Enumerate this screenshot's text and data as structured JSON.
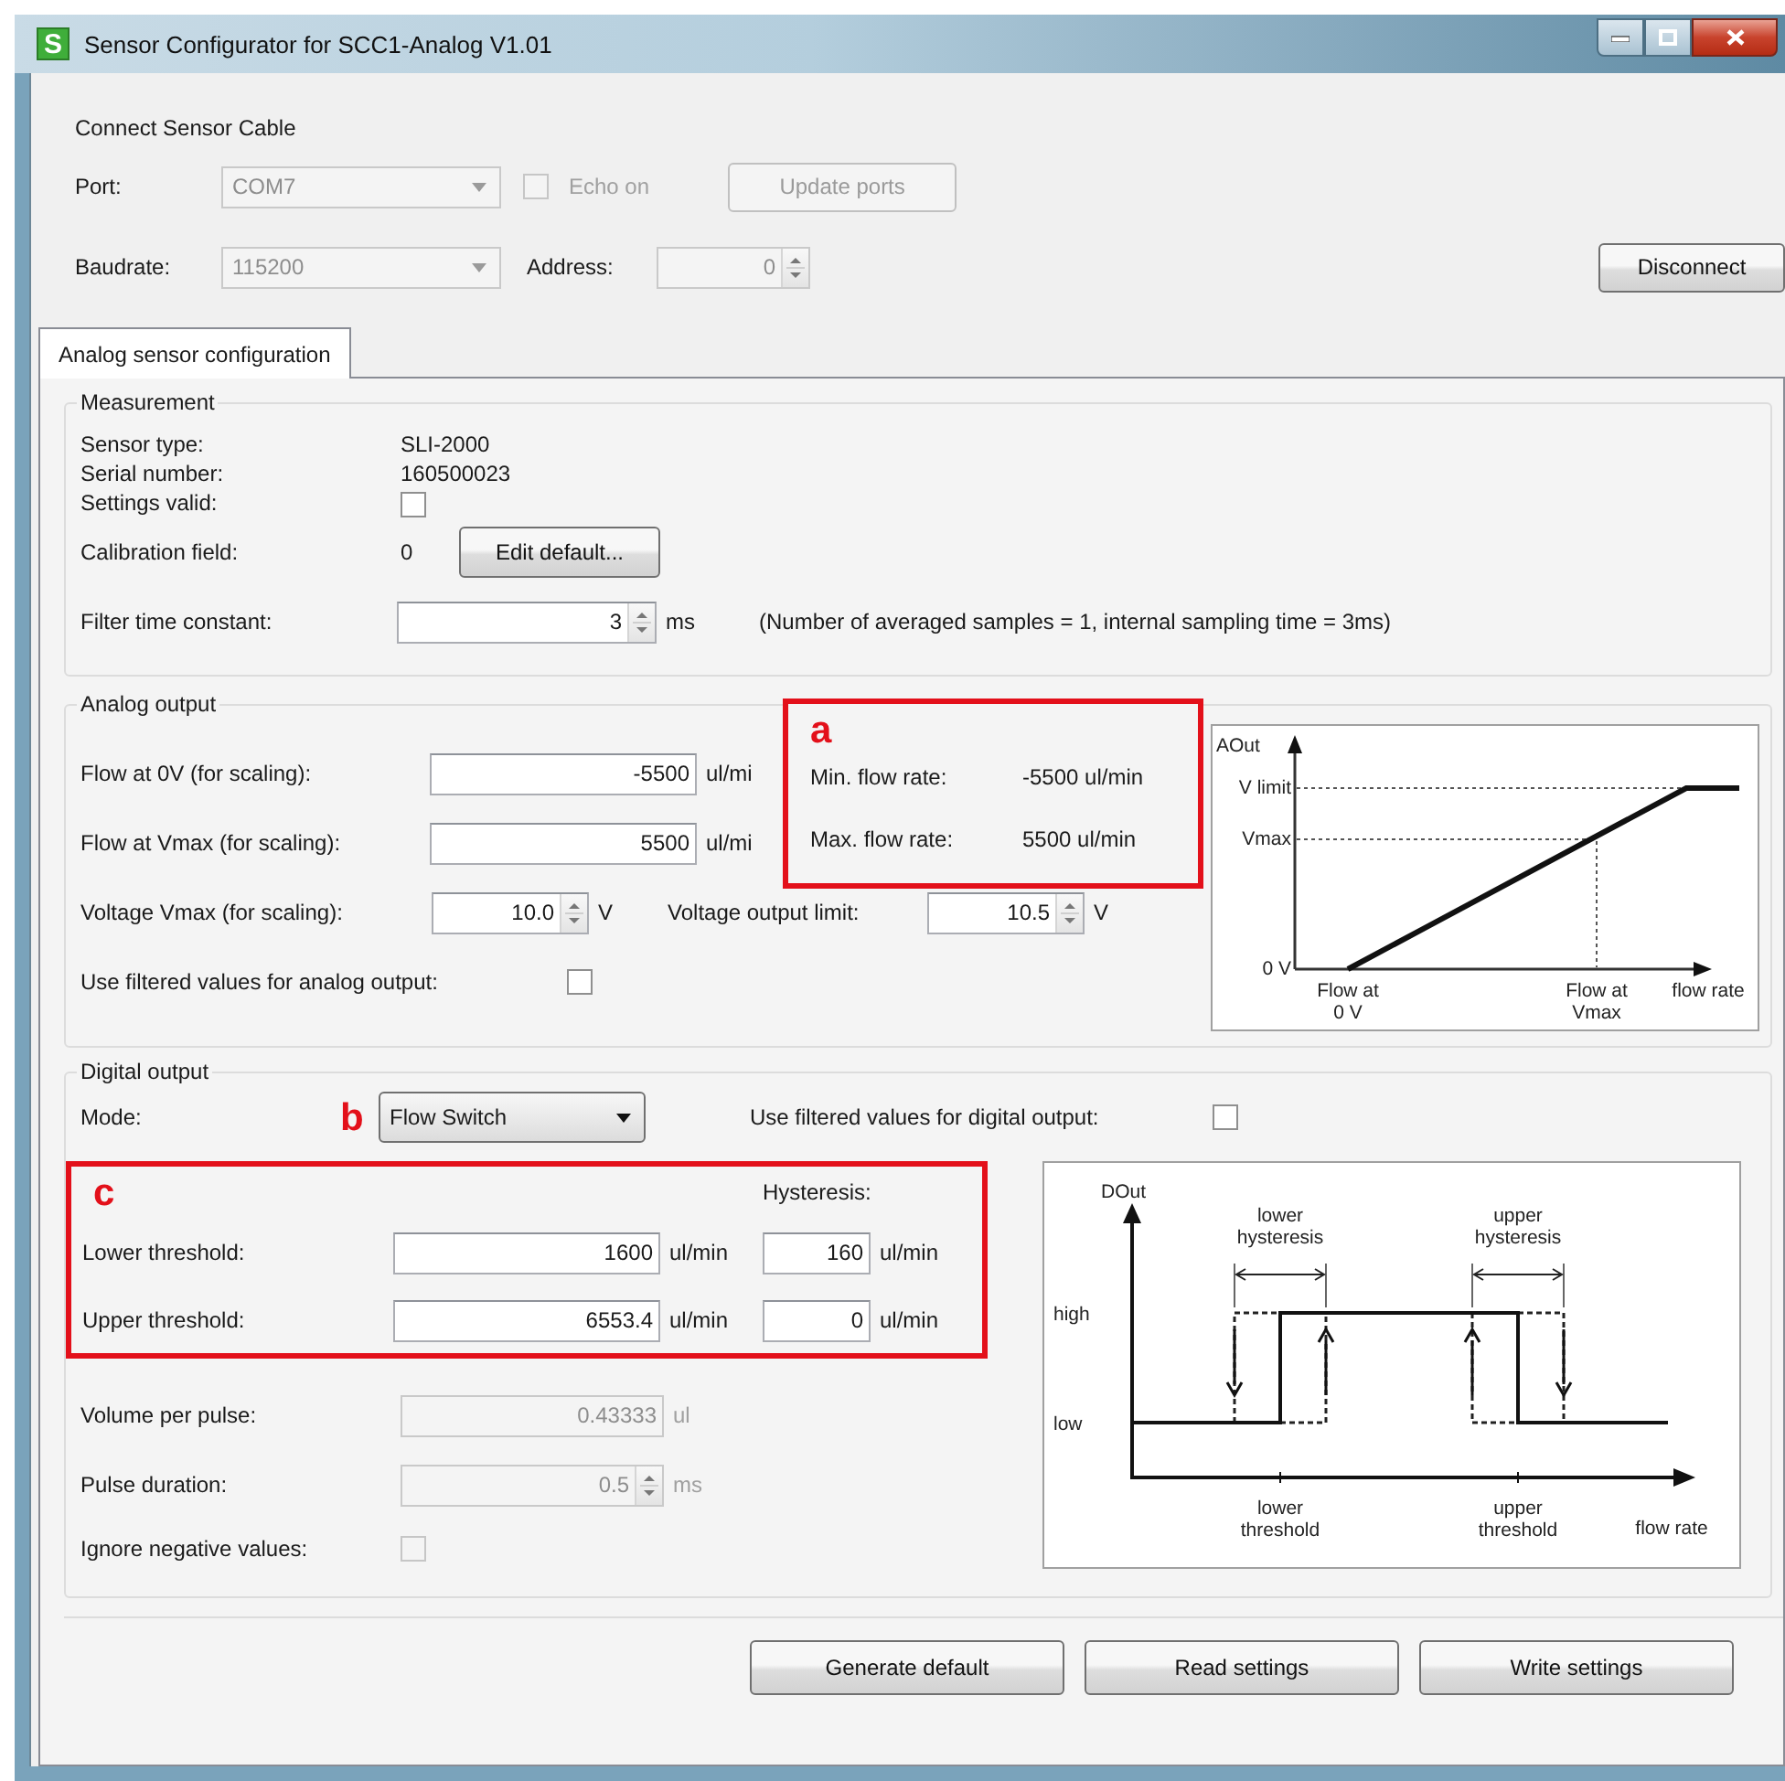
{
  "window": {
    "title": "Sensor Configurator for SCC1-Analog V1.01",
    "icon_letter": "S"
  },
  "connection": {
    "title": "Connect Sensor Cable",
    "port": {
      "label": "Port:",
      "value": "COM7",
      "disabled": true
    },
    "echo": {
      "label": "Echo on",
      "checked": false,
      "disabled": true
    },
    "update_button": {
      "label": "Update ports",
      "disabled": true
    },
    "baudrate": {
      "label": "Baudrate:",
      "value": "115200",
      "disabled": true
    },
    "address": {
      "label": "Address:",
      "value": "0",
      "disabled": true
    },
    "disconnect_button": {
      "label": "Disconnect",
      "disabled": false
    }
  },
  "tabs": [
    {
      "label": "Analog sensor configuration",
      "selected": true
    }
  ],
  "measurement": {
    "title": "Measurement",
    "info": [
      {
        "label": "Sensor type:",
        "value": "SLI-2000"
      },
      {
        "label": "Serial number:",
        "value": "160500023"
      }
    ],
    "settings_valid": {
      "label": "Settings valid:",
      "checked": false
    },
    "calibration": {
      "label": "Calibration field:",
      "value": "0",
      "button": "Edit default..."
    },
    "filter": {
      "label": "Filter time constant:",
      "value": "3",
      "unit": "ms",
      "disabled": false,
      "note": "(Number of averaged samples = 1, internal sampling time = 3ms)"
    }
  },
  "analog_output": {
    "title": "Analog output",
    "flow_at_0v": {
      "label": "Flow at 0V (for scaling):",
      "value": "-5500",
      "unit": "ul/mi",
      "disabled": false
    },
    "flow_at_vmax": {
      "label": "Flow at Vmax (for scaling):",
      "value": "5500",
      "unit": "ul/mi",
      "disabled": false
    },
    "annotation": "a",
    "min_flow": {
      "label": "Min. flow rate:",
      "value": "-5500 ul/min"
    },
    "max_flow": {
      "label": "Max. flow rate:",
      "value": "5500 ul/min"
    },
    "voltage_vmax": {
      "label": "Voltage Vmax (for scaling):",
      "value": "10.0",
      "unit": "V",
      "disabled": false
    },
    "voltage_limit": {
      "label": "Voltage output limit:",
      "value": "10.5",
      "unit": "V",
      "disabled": false
    },
    "use_filtered": {
      "label": "Use filtered values for analog output:",
      "checked": false
    },
    "diagram": {
      "y_axis": "AOut",
      "levels": [
        "V limit",
        "Vmax",
        "0 V"
      ],
      "x_labels": [
        [
          "Flow at",
          "0 V"
        ],
        [
          "Flow at",
          "Vmax"
        ],
        [
          "flow rate"
        ]
      ]
    }
  },
  "digital_output": {
    "title": "Digital output",
    "mode": {
      "label": "Mode:",
      "annotation": "b",
      "value": "Flow Switch"
    },
    "use_filtered": {
      "label": "Use filtered values for digital output:",
      "checked": false
    },
    "annotation": "c",
    "hysteresis_heading": "Hysteresis:",
    "thresholds": [
      {
        "label": "Lower threshold:",
        "value": "1600",
        "unit": "ul/min",
        "hysteresis": "160",
        "hysteresis_unit": "ul/min"
      },
      {
        "label": "Upper threshold:",
        "value": "6553.4",
        "unit": "ul/min",
        "hysteresis": "0",
        "hysteresis_unit": "ul/min"
      }
    ],
    "volume_per_pulse": {
      "label": "Volume per pulse:",
      "value": "0.43333",
      "unit": "ul",
      "disabled": true
    },
    "pulse_duration": {
      "label": "Pulse duration:",
      "value": "0.5",
      "unit": "ms",
      "disabled": true
    },
    "ignore_negative": {
      "label": "Ignore negative values:",
      "checked": false,
      "disabled": true
    },
    "diagram": {
      "y_axis": "DOut",
      "levels": [
        "high",
        "low"
      ],
      "hysteresis_labels": [
        [
          "lower",
          "hysteresis"
        ],
        [
          "upper",
          "hysteresis"
        ]
      ],
      "x_labels": [
        [
          "lower",
          "threshold"
        ],
        [
          "upper",
          "threshold"
        ],
        [
          "flow rate"
        ]
      ]
    }
  },
  "buttons": [
    "Generate default",
    "Read settings",
    "Write settings"
  ]
}
